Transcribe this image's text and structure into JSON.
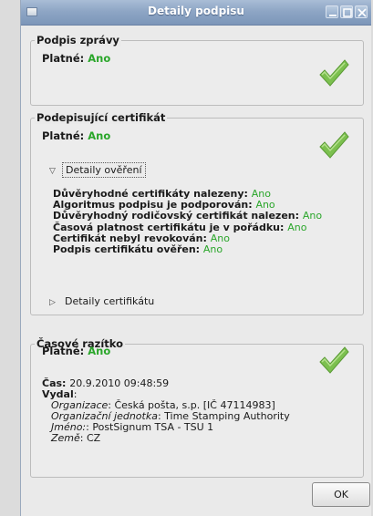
{
  "window": {
    "title": "Detaily podpisu"
  },
  "message_signature": {
    "heading": "Podpis zprávy",
    "valid_label": "Platné:",
    "valid_value": "Ano"
  },
  "signing_certificate": {
    "heading": "Podepisující certifikát",
    "valid_label": "Platné:",
    "valid_value": "Ano",
    "verification_expander": "Detaily ověření",
    "checks": [
      {
        "label": "Důvěryhodné certifikáty nalezeny",
        "value": "Ano"
      },
      {
        "label": "Algoritmus podpisu je podporován",
        "value": "Ano"
      },
      {
        "label": "Důvěryhodný rodičovský certifikát nalezen",
        "value": "Ano"
      },
      {
        "label": "Časová platnost certifikátu je v pořádku",
        "value": "Ano"
      },
      {
        "label": "Certifikát nebyl revokován",
        "value": "Ano"
      },
      {
        "label": "Podpis certifikátu ověřen",
        "value": "Ano"
      }
    ],
    "certificate_expander": "Detaily certifikátu"
  },
  "timestamp": {
    "heading": "Časové razítko",
    "valid_label": "Platné:",
    "valid_value": "Ano",
    "time_label": "Čas",
    "time_value": "20.9.2010 09:48:59",
    "issuer_label": "Vydal",
    "issuer": [
      {
        "label": "Organizace",
        "sep": ": ",
        "value": "Česká pošta, s.p. [IČ 47114983]"
      },
      {
        "label": "Organizační jednotka",
        "sep": ": ",
        "value": "Time Stamping Authority"
      },
      {
        "label": "Jméno:",
        "sep": ": ",
        "value": "PostSignum TSA - TSU 1"
      },
      {
        "label": "Země",
        "sep": ": ",
        "value": "CZ"
      }
    ]
  },
  "buttons": {
    "ok": "OK"
  },
  "colors": {
    "valid_green": "#2aa62a",
    "titlebar": "#8ea6c5"
  },
  "icons": [
    "app-icon",
    "minimize-icon",
    "maximize-icon",
    "close-icon",
    "checkmark-icon",
    "triangle-down-icon",
    "triangle-right-icon"
  ]
}
